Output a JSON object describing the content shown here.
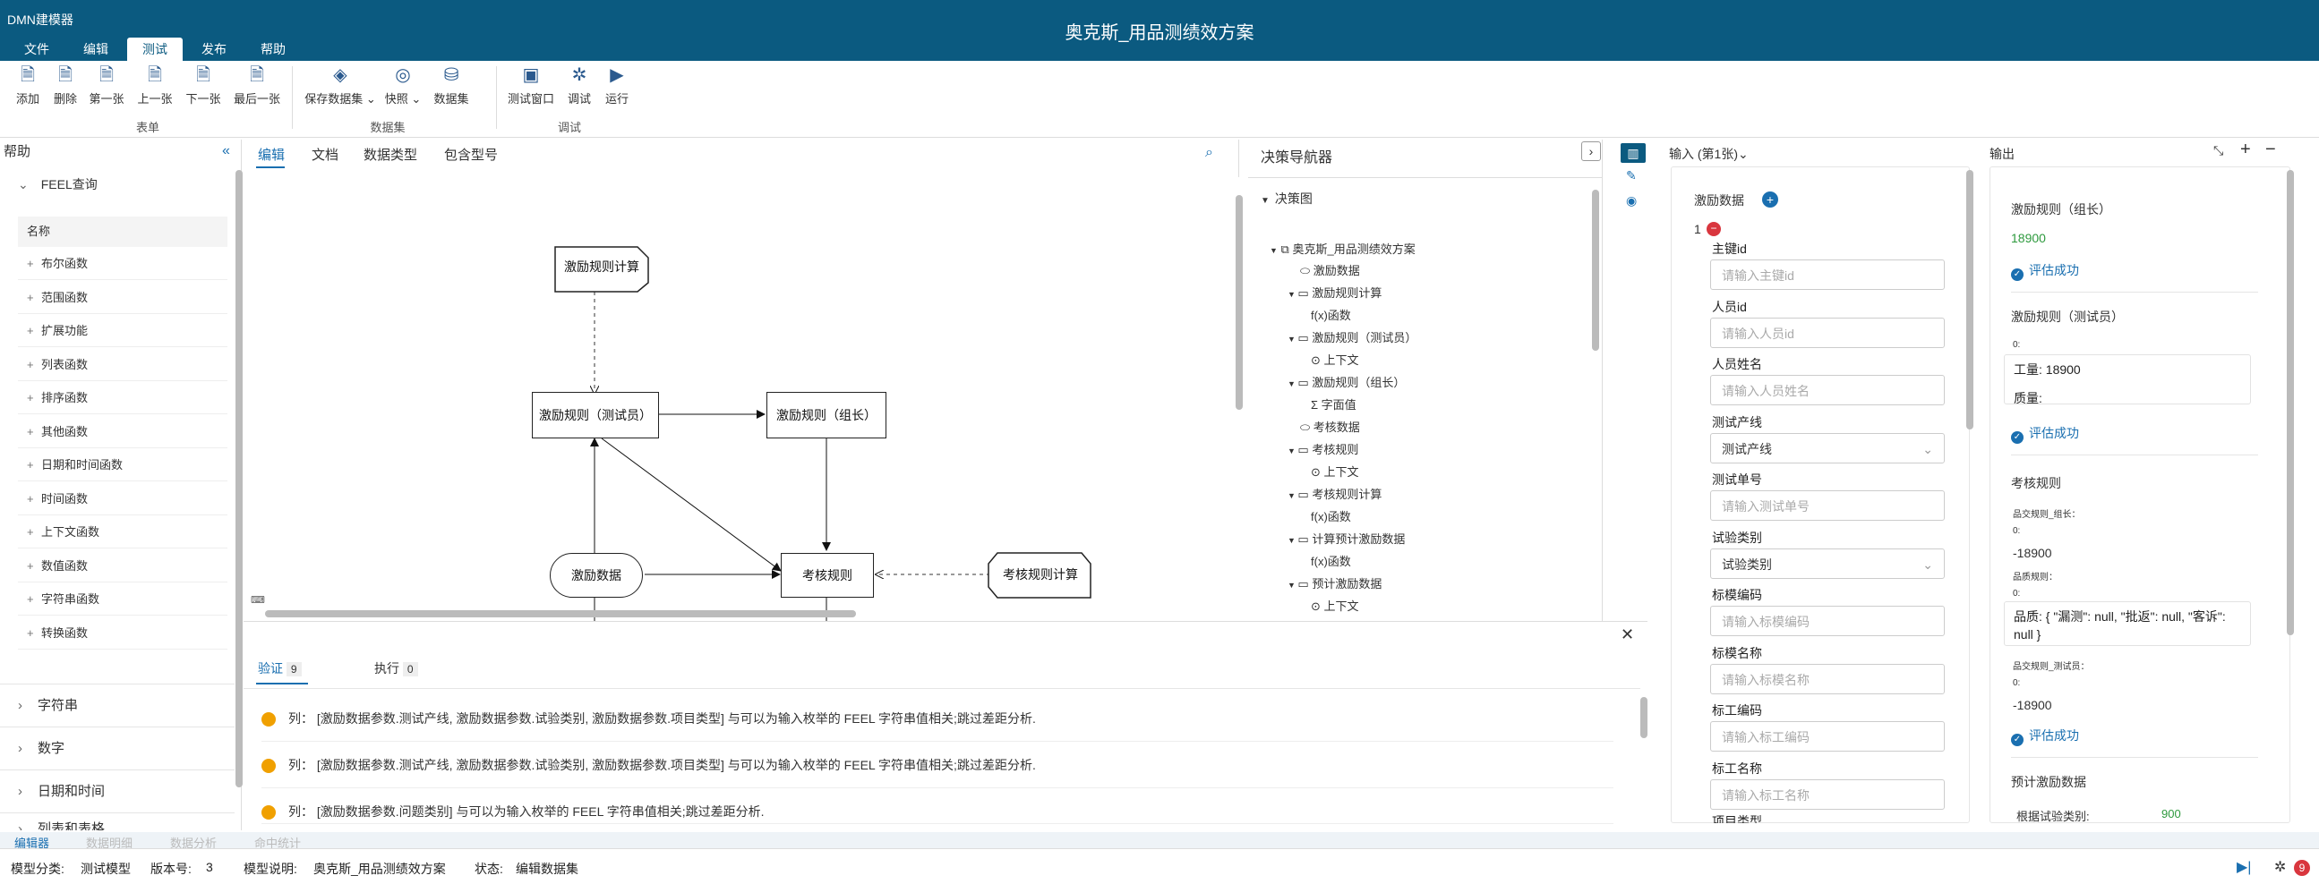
{
  "app": {
    "name": "DMN建模器",
    "title": "奥克斯_用品测绩效方案"
  },
  "menu": {
    "tabs": [
      "文件",
      "编辑",
      "测试",
      "发布",
      "帮助"
    ],
    "active": "测试"
  },
  "ribbon": {
    "form_buttons": [
      "添加",
      "删除",
      "第一张",
      "上一张",
      "下一张",
      "最后一张"
    ],
    "form_group": "表单",
    "dataset_buttons": [
      "保存数据集",
      "快照",
      "数据集"
    ],
    "dataset_group": "数据集",
    "debug_buttons": [
      "测试窗口",
      "调试",
      "运行"
    ],
    "debug_group": "调试"
  },
  "left_panel": {
    "title": "帮助",
    "feel_section": "FEEL查询",
    "column_header": "名称",
    "functions": [
      "布尔函数",
      "范围函数",
      "扩展功能",
      "列表函数",
      "排序函数",
      "其他函数",
      "日期和时间函数",
      "时间函数",
      "上下文函数",
      "数值函数",
      "字符串函数",
      "转换函数"
    ],
    "sections": [
      "字符串",
      "数字",
      "日期和时间",
      "列表和表格"
    ]
  },
  "editor": {
    "tabs": [
      "编辑",
      "文档",
      "数据类型",
      "包含型号"
    ],
    "nodes": {
      "calc": "激励规则计算",
      "tester": "激励规则（测试员）",
      "leader": "激励规则（组长）",
      "data": "激励数据",
      "review": "考核规则",
      "review_calc": "考核规则计算"
    }
  },
  "navigator": {
    "title": "决策导航器",
    "section": "决策图",
    "root": "奥克斯_用品测绩效方案",
    "items": [
      {
        "label": "激励数据",
        "icon": "input-data-icon",
        "level": 1
      },
      {
        "label": "激励规则计算",
        "icon": "decision-icon",
        "level": 1
      },
      {
        "label": "f(x)函数",
        "icon": "function-icon",
        "level": 2
      },
      {
        "label": "激励规则（测试员）",
        "icon": "decision-icon",
        "level": 1
      },
      {
        "label": "上下文",
        "icon": "context-icon",
        "level": 2
      },
      {
        "label": "激励规则（组长）",
        "icon": "decision-icon",
        "level": 1
      },
      {
        "label": "Σ 字面值",
        "icon": "literal-icon",
        "level": 2
      },
      {
        "label": "考核数据",
        "icon": "input-data-icon",
        "level": 1
      },
      {
        "label": "考核规则",
        "icon": "decision-icon",
        "level": 1
      },
      {
        "label": "上下文",
        "icon": "context-icon",
        "level": 2
      },
      {
        "label": "考核规则计算",
        "icon": "decision-icon",
        "level": 1
      },
      {
        "label": "f(x)函数",
        "icon": "function-icon",
        "level": 2
      },
      {
        "label": "计算预计激励数据",
        "icon": "decision-icon",
        "level": 1
      },
      {
        "label": "f(x)函数",
        "icon": "function-icon",
        "level": 2
      },
      {
        "label": "预计激励数据",
        "icon": "decision-icon",
        "level": 1
      },
      {
        "label": "上下文",
        "icon": "context-icon",
        "level": 2
      }
    ]
  },
  "inputs": {
    "title": "输入 (第1张)",
    "group": "激励数据",
    "index": "1",
    "fields": [
      {
        "label": "主键id",
        "placeholder": "请输入主键id"
      },
      {
        "label": "人员id",
        "placeholder": "请输入人员id"
      },
      {
        "label": "人员姓名",
        "placeholder": "请输入人员姓名"
      },
      {
        "label": "测试产线",
        "placeholder": "测试产线",
        "select": true
      },
      {
        "label": "测试单号",
        "placeholder": "请输入测试单号"
      },
      {
        "label": "试验类别",
        "placeholder": "试验类别",
        "select": true
      },
      {
        "label": "标模编码",
        "placeholder": "请输入标模编码"
      },
      {
        "label": "标模名称",
        "placeholder": "请输入标模名称"
      },
      {
        "label": "标工编码",
        "placeholder": "请输入标工编码"
      },
      {
        "label": "标工名称",
        "placeholder": "请输入标工名称"
      }
    ],
    "cut_label": "项目类型"
  },
  "outputs": {
    "title": "输出",
    "leader_label": "激励规则（组长）",
    "leader_value": "18900",
    "success": "评估成功",
    "tester_label": "激励规则（测试员）",
    "zero": "0:",
    "tester_work": "工量: 18900",
    "tester_quality": "质量:",
    "review_label": "考核规则",
    "review_leader": "品交规则_组长：",
    "review_leader_value": "-18900",
    "quality_rule": "品质规则：",
    "quality_text": "品质: { \"漏测\": null, \"批返\": null, \"客诉\": null }",
    "review_tester": "品交规则_测试员：",
    "review_tester_value": "-18900",
    "forecast_label": "预计激励数据",
    "forecast_row_label": "根据试验类别:",
    "forecast_row_value": "900"
  },
  "bottom": {
    "tabs": [
      {
        "label": "验证",
        "count": "9"
      },
      {
        "label": "执行",
        "count": "0"
      }
    ],
    "messages": [
      "列： [激励数据参数.测试产线, 激励数据参数.试验类别, 激励数据参数.项目类型] 与可以为输入枚举的 FEEL 字符串值相关;跳过差距分析.",
      "列： [激励数据参数.测试产线, 激励数据参数.试验类别, 激励数据参数.项目类型] 与可以为输入枚举的 FEEL 字符串值相关;跳过差距分析.",
      "列： [激励数据参数.问题类别] 与可以为输入枚举的 FEEL 字符串值相关;跳过差距分析."
    ]
  },
  "status_tabs": [
    "编辑器",
    "数据明细",
    "数据分析",
    "命中统计"
  ],
  "status": {
    "category_label": "模型分类:",
    "category": "测试模型",
    "version_label": "版本号:",
    "version": "3",
    "desc_label": "模型说明:",
    "desc": "奥克斯_用品测绩效方案",
    "state_label": "状态:",
    "state": "编辑数据集",
    "badge": "9"
  },
  "colors": {
    "titlebar": "#0b5a80",
    "accent": "#1a6fb0",
    "warn": "#f0a000",
    "success_value": "#2e9a3e"
  }
}
